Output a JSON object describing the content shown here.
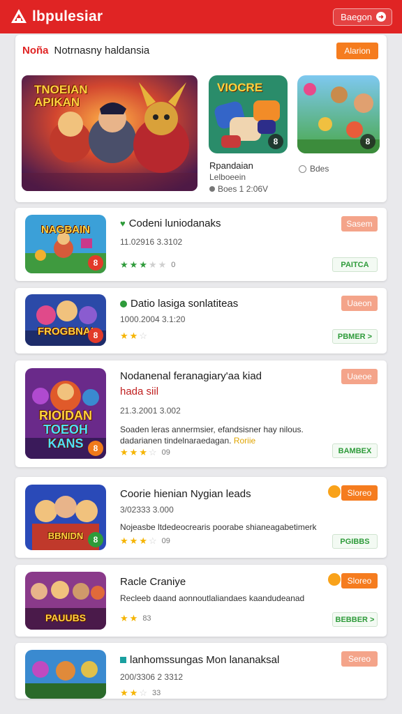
{
  "header": {
    "title": "lbpulesiar",
    "button_label": "Baegon",
    "button_icon": "arrow-right-icon"
  },
  "featured": {
    "tag": "Noña",
    "title": "Notrnasny haldansia",
    "button_label": "Alarion",
    "hero": {
      "title_line1": "TNOEIAN",
      "title_line2": "APIKAN"
    },
    "tile1": {
      "title": "VIOCRE",
      "badge": "8"
    },
    "tile2": {
      "badge": "8"
    },
    "name": "Rpandaian",
    "subtitle": "Lelboeein",
    "date": "Boes 1 2:06V",
    "likes": "Bdes"
  },
  "items": [
    {
      "title": "Codeni luniodanaks",
      "date": "11.02916 3.3102",
      "tag": "Sasem",
      "action": "PAITCA",
      "thumb_title": "NAGBAIN",
      "badge": "8",
      "rating_count": "0",
      "rating": 3
    },
    {
      "title": "Datio lasiga sonlatiteas",
      "date": "1000.2004 3.1:20",
      "tag": "Uaeon",
      "action": "PBMER >",
      "thumb_title": "FROGBNAI",
      "badge": "8",
      "rating_count": "",
      "rating": 2
    },
    {
      "title": "Nodanenal feranagiary'aa kiad",
      "title_line2": "hada siil",
      "date": "21.3.2001 3.002",
      "description": "Soaden leras annermsier, efandsisner hay nilous.",
      "description_line2": "dadarianen tindelnaraedagan.",
      "highlight": "Roriie",
      "tag": "Uaeoe",
      "action": "BAMBEX",
      "thumb_title": "RIOIDAN",
      "thumb_title2": "TOEOH KANS",
      "badge": "8",
      "rating_count": "09",
      "rating": 3
    },
    {
      "title": "Coorie hienian Nygian leads",
      "date": "3/02333 3.000",
      "description": "Nojeasbe ltdedeocrearis poorabe shianeagabetimerk",
      "tag": "Sloreo",
      "action": "PGIBBS",
      "thumb_title": "BBNIDN",
      "badge": "8",
      "rating_count": "09",
      "rating": 3
    },
    {
      "title": "Racle Craniye",
      "description": "Recleeb daand aonnoutlaliandaes kaandudeanad",
      "tag": "Sloreo",
      "action": "BEBBER >",
      "thumb_title": "PAUUBS",
      "badge": "",
      "rating_count": "83",
      "rating": 2
    },
    {
      "title": "lanhomssungas Mon lananaksal",
      "date": "200/3306 2 3312",
      "tag": "Sereo",
      "thumb_title": "",
      "badge": "",
      "rating_count": "33",
      "rating": 2
    }
  ],
  "colors": {
    "brand_red": "#e02424",
    "accent_orange": "#f57c1f",
    "star": "#f5b400",
    "action_green": "#2e9b3a"
  }
}
